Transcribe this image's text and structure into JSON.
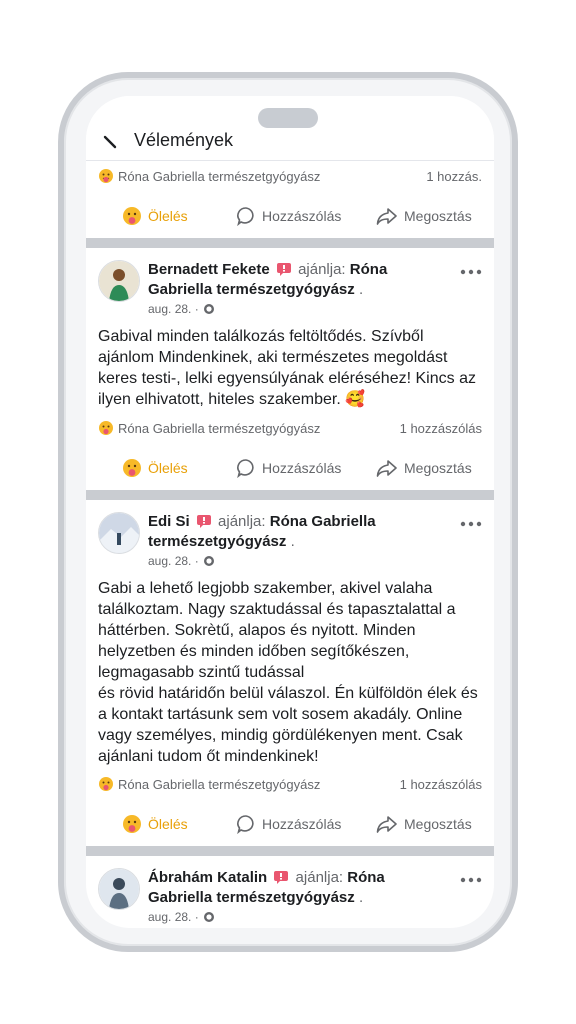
{
  "header": {
    "title": "Vélemények"
  },
  "page_name": "Róna Gabriella természetgyógyász",
  "colors": {
    "hug": "#e8a008",
    "muted": "#65676b",
    "divider": "#c9ccd1",
    "flag": "#e9566f"
  },
  "actions": {
    "hug": "Ölelés",
    "comment": "Hozzászólás",
    "share": "Megosztás"
  },
  "top_meta": {
    "page": "Róna Gabriella természetgyógyász",
    "count": "1 hozzás."
  },
  "posts": [
    {
      "author": "Bernadett Fekete",
      "recommends": "ajánlja:",
      "target": "Róna Gabriella természetgyógyász",
      "trail": ".",
      "date": "aug. 28. ·",
      "body": "Gabival minden találkozás feltöltődés. Szívből ajánlom Mindenkinek, aki természetes megoldást keres testi-, lelki egyensúlyának eléréséhez! Kincs az ilyen elhivatott, hiteles szakember. 🥰",
      "meta_page": "Róna Gabriella természetgyógyász",
      "comment_count": "1 hozzászólás"
    },
    {
      "author": "Edi Si",
      "recommends": "ajánlja:",
      "target": "Róna Gabriella természetgyógyász",
      "trail": ".",
      "date": "aug. 28. ·",
      "body_lines": [
        "Gabi a lehető legjobb szakember, akivel valaha találkoztam. Nagy szaktudással és tapasztalattal a háttérben. Sokrètű, alapos és nyitott. Minden helyzetben és minden időben segítőkészen, legmagasabb szintű tudással",
        "és rövid határidőn belül válaszol. Én külföldön élek és a kontakt tartásunk sem volt sosem akadály. Online vagy személyes, mindig gördülékenyen ment. Csak ajánlani tudom őt mindenkinek!"
      ],
      "meta_page": "Róna Gabriella természetgyógyász",
      "comment_count": "1 hozzászólás"
    },
    {
      "author": "Ábrahám Katalin",
      "recommends": "ajánlja:",
      "target": "Róna Gabriella természetgyógyász",
      "trail": ".",
      "date": "aug. 28. ·"
    }
  ]
}
